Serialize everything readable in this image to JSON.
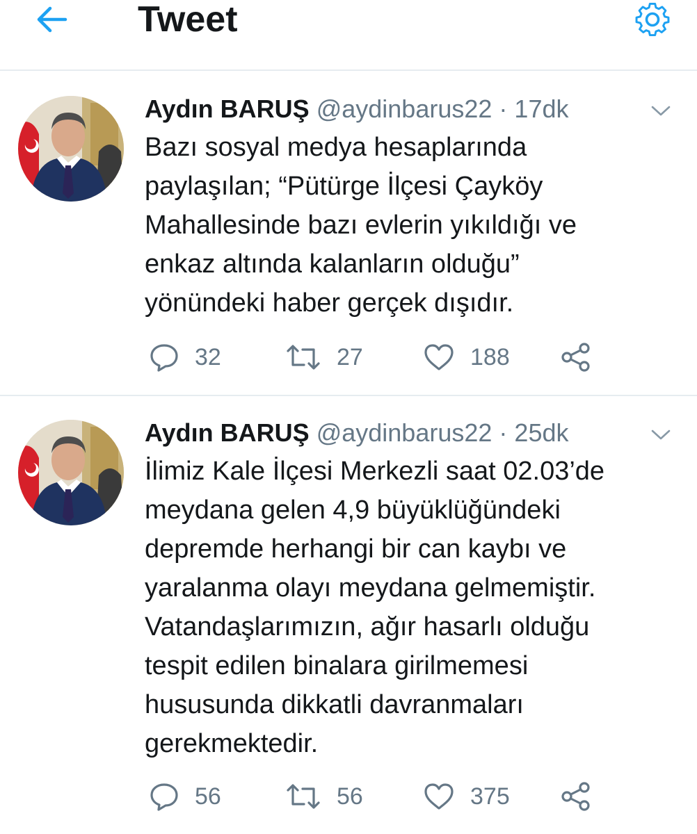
{
  "header": {
    "title": "Tweet",
    "back_icon": "back-arrow-icon",
    "settings_icon": "gear-icon"
  },
  "colors": {
    "accent": "#1da1f2",
    "text_primary": "#14171a",
    "text_secondary": "#657786",
    "divider": "#e6ecf0"
  },
  "tweets": [
    {
      "author_name": "Aydın BARUŞ",
      "handle": "@aydinbarus22",
      "separator": "·",
      "time": "17dk",
      "text": "Bazı sosyal medya hesaplarında\npaylaşılan; “Pütürge İlçesi Çayköy\nMahallesinde bazı evlerin yıkıldığı ve\nenkaz altında kalanların olduğu”\nyönündeki haber gerçek dışıdır.",
      "replies": "32",
      "retweets": "27",
      "likes": "188"
    },
    {
      "author_name": "Aydın BARUŞ",
      "handle": "@aydinbarus22",
      "separator": "·",
      "time": "25dk",
      "text": "İlimiz Kale İlçesi Merkezli saat 02.03’de\nmeydana gelen 4,9 büyüklüğündeki\ndepremde herhangi bir can kaybı ve\nyaralanma olayı meydana gelmemiştir.\nVatandaşlarımızın, ağır hasarlı olduğu\ntespit edilen binalara girilmemesi\nhususunda dikkatli davranmaları\ngerekmektedir.",
      "replies": "56",
      "retweets": "56",
      "likes": "375"
    }
  ]
}
